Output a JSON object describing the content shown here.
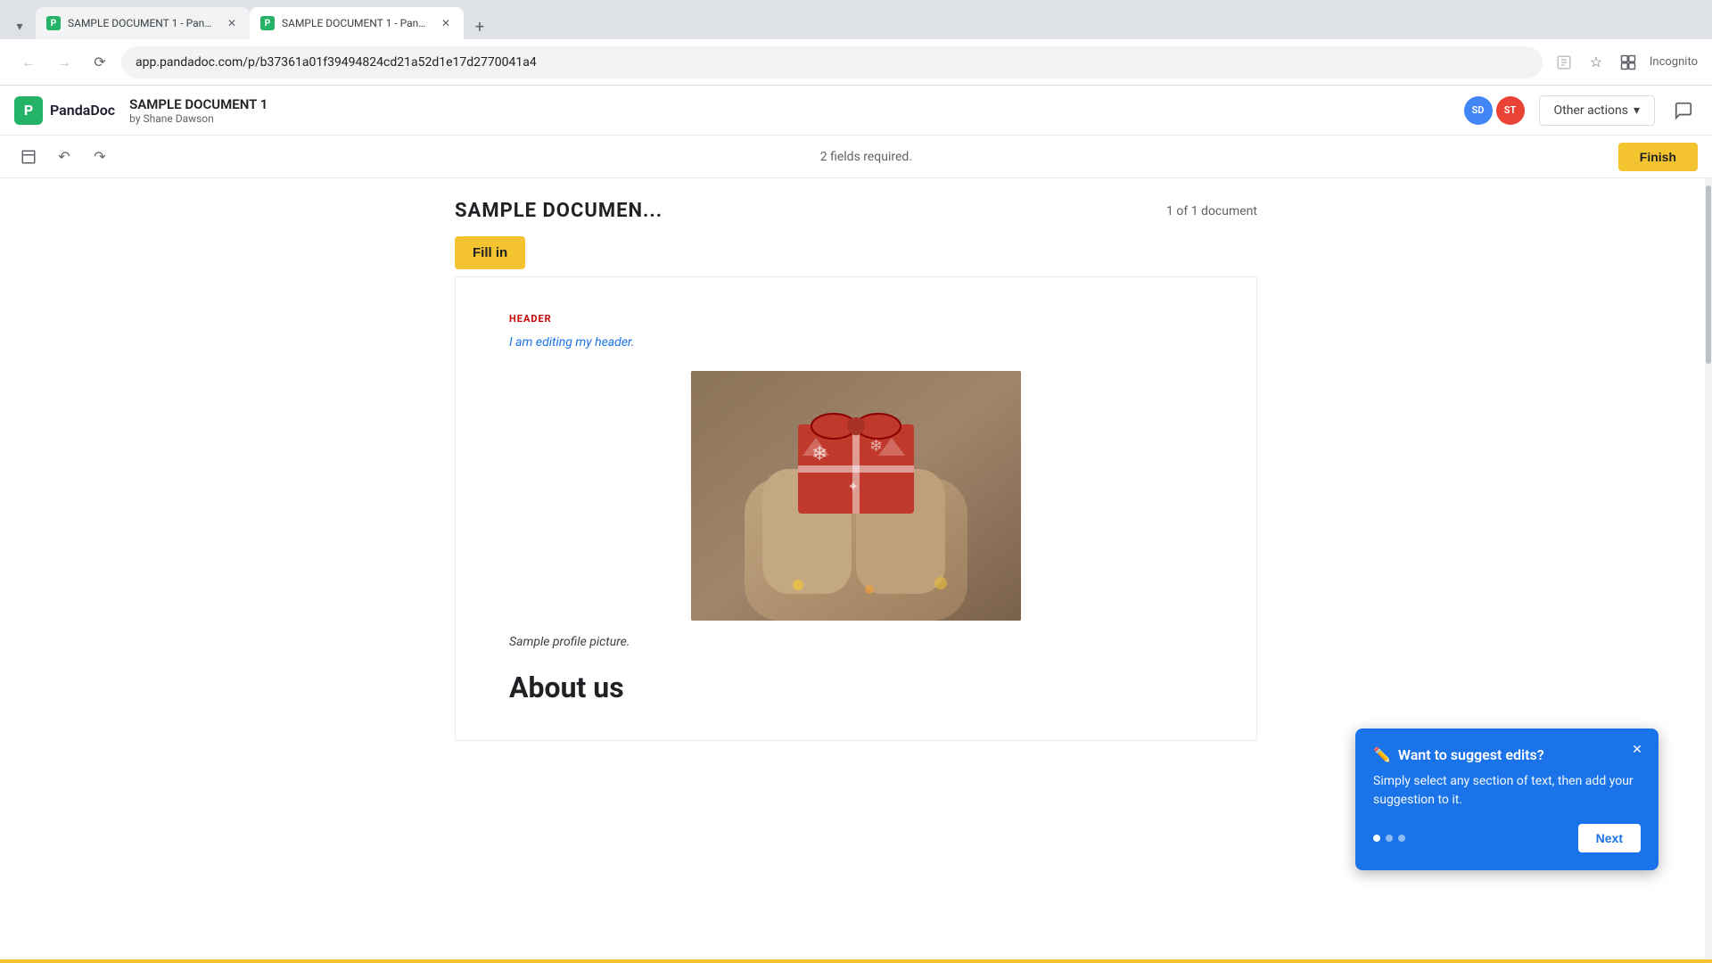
{
  "browser": {
    "tabs": [
      {
        "id": "tab1",
        "favicon": "P",
        "title": "SAMPLE DOCUMENT 1 - Panda...",
        "active": false
      },
      {
        "id": "tab2",
        "favicon": "P",
        "title": "SAMPLE DOCUMENT 1 - Panda...",
        "active": true
      }
    ],
    "address": "app.pandadoc.com/p/b37361a01f39494824cd21a52d1e17d2770041a4",
    "new_tab_label": "+"
  },
  "app": {
    "logo_text": "PandaDoc",
    "doc_title": "SAMPLE DOCUMENT 1",
    "doc_author": "by Shane Dawson",
    "avatars": [
      {
        "initials": "SD",
        "color": "#4285f4"
      },
      {
        "initials": "ST",
        "color": "#ea4335"
      }
    ],
    "other_actions_label": "Other actions",
    "fields_required": "2 fields required.",
    "finish_label": "Finish"
  },
  "document": {
    "title": "SAMPLE DOCUMEN...",
    "count": "1 of 1 document",
    "fill_in_label": "Fill in",
    "header_section": "HEADER",
    "header_text": "I am editing my header.",
    "caption": "Sample profile picture.",
    "about_heading": "About us"
  },
  "suggest_popup": {
    "title": "Want to suggest edits?",
    "body": "Simply select any section of text, then add your suggestion to it.",
    "next_label": "Next",
    "dots": [
      true,
      false,
      false
    ]
  }
}
